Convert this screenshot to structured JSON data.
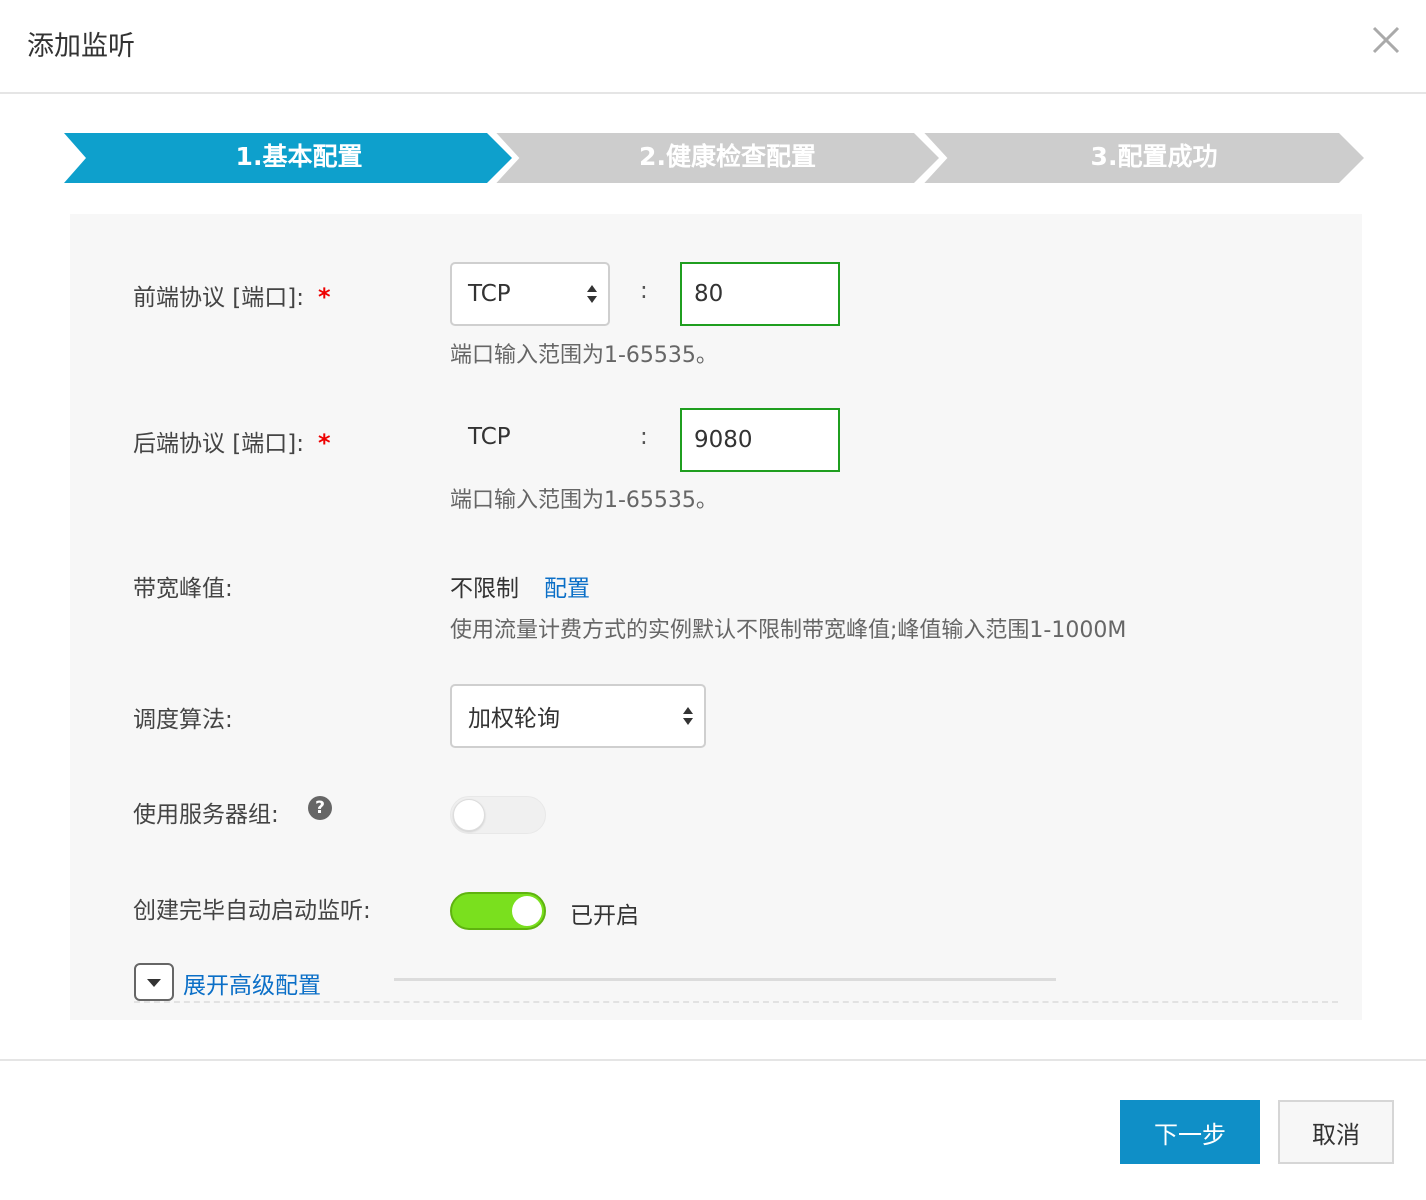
{
  "dialog": {
    "title": "添加监听",
    "close_icon": "close-icon"
  },
  "steps": [
    {
      "label": "1.基本配置",
      "active": true
    },
    {
      "label": "2.健康检查配置",
      "active": false
    },
    {
      "label": "3.配置成功",
      "active": false
    }
  ],
  "colors": {
    "step_active": "#0ea0cc",
    "step_inactive": "#cdcdcd",
    "link": "#0b6fc7",
    "toggle_on": "#7ae01e",
    "primary_button": "#0f8fc7",
    "valid_border": "#1f9e1f"
  },
  "frontend": {
    "label": "前端协议 [端口]:",
    "required_mark": "*",
    "protocol": "TCP",
    "colon": ":",
    "port": "80",
    "hint": "端口输入范围为1-65535。"
  },
  "backend": {
    "label": "后端协议 [端口]:",
    "required_mark": "*",
    "protocol": "TCP",
    "colon": ":",
    "port": "9080",
    "hint": "端口输入范围为1-65535。"
  },
  "bandwidth": {
    "label": "带宽峰值:",
    "value": "不限制",
    "config_link": "配置",
    "hint": "使用流量计费方式的实例默认不限制带宽峰值;峰值输入范围1-1000M"
  },
  "scheduler": {
    "label": "调度算法:",
    "value": "加权轮询"
  },
  "server_group": {
    "label": "使用服务器组:",
    "help": "?",
    "enabled": false
  },
  "autostart": {
    "label": "创建完毕自动启动监听:",
    "enabled": true,
    "status": "已开启"
  },
  "advanced": {
    "label": "展开高级配置"
  },
  "footer": {
    "next": "下一步",
    "cancel": "取消"
  }
}
